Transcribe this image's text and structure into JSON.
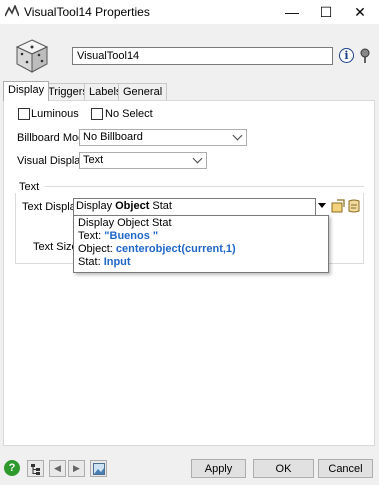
{
  "window": {
    "title": "VisualTool14  Properties",
    "minimize_glyph": "—",
    "maximize_glyph": "☐",
    "close_glyph": "✕"
  },
  "header": {
    "name_value": "VisualTool14",
    "info_glyph": "i"
  },
  "tabs": [
    {
      "label": "Display",
      "active": true
    },
    {
      "label": "Triggers",
      "active": false
    },
    {
      "label": "Labels",
      "active": false
    },
    {
      "label": "General",
      "active": false
    }
  ],
  "display": {
    "luminous_label": "Luminous",
    "luminous_checked": false,
    "noselect_label": "No Select",
    "noselect_checked": false,
    "billboard_label": "Billboard Mode",
    "billboard_value": "No Billboard",
    "visual_display_label": "Visual Display",
    "visual_display_value": "Text",
    "text_group_label": "Text",
    "text_display_label": "Text Display",
    "text_display_prefix": "Display ",
    "text_display_bold": "Object",
    "text_display_suffix": " Stat",
    "text_size_label": "Text Size"
  },
  "popup": {
    "line1": "Display Object Stat",
    "text_key": "Text: ",
    "text_val": "\"Buenos \"",
    "object_key": "Object: ",
    "object_val": "centerobject(current,1)",
    "stat_key": "Stat: ",
    "stat_val": "Input"
  },
  "footer": {
    "help_glyph": "?",
    "prev_glyph": "◀",
    "next_glyph": "▶",
    "apply_label": "Apply",
    "ok_label": "OK",
    "cancel_label": "Cancel"
  },
  "colors": {
    "accent_blue": "#1f66c9",
    "help_green": "#2e9a2e"
  }
}
